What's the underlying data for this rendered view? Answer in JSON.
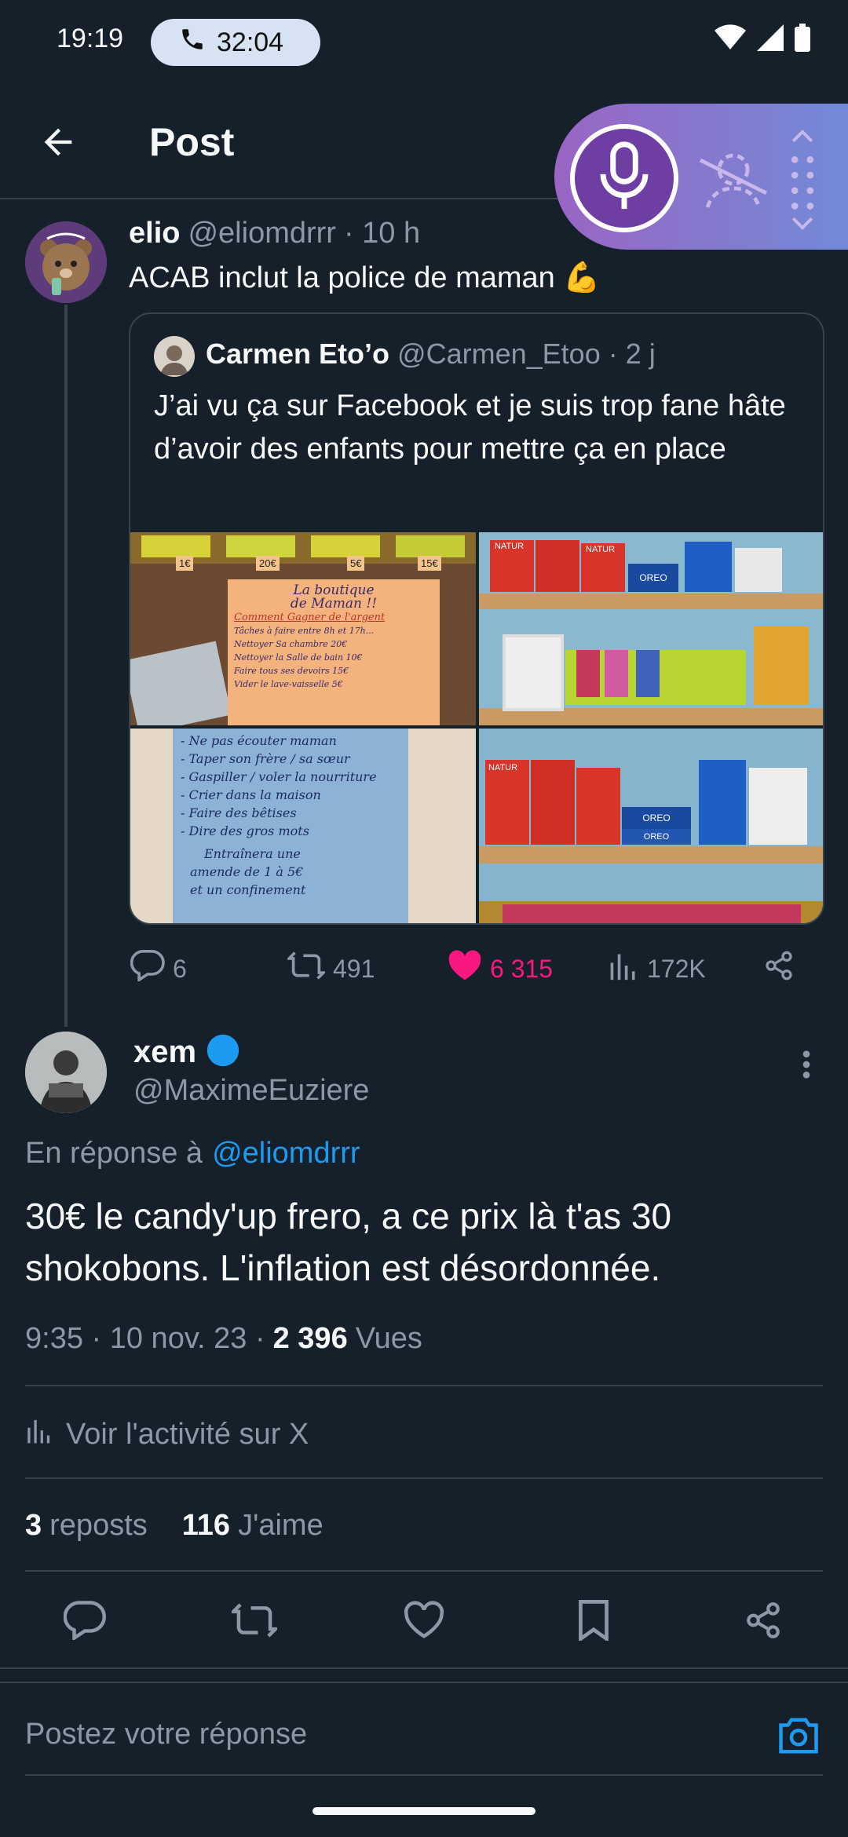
{
  "status": {
    "time": "19:19",
    "call_duration": "32:04"
  },
  "header": {
    "title": "Post"
  },
  "tweet": {
    "author_name": "elio",
    "author_handle": "@eliomdrrr",
    "age": "· 10 h",
    "text": "ACAB inclut la police de maman 💪",
    "quote": {
      "author_name": "Carmen Eto’o",
      "author_handle": "@Carmen_Etoo",
      "age": "· 2 j",
      "text": "J’ai vu ça sur Facebook et je suis trop fane hâte d’avoir des enfants pour mettre ça en place",
      "images": [
        {
          "lines": [
            "La boutique",
            "de Maman !!",
            "Comment Gagner de l'argent",
            "Tâches à faire entre 8h et 17h...",
            "Nettoyer Sa chambre 20€",
            "Nettoyer la Salle de bain 10€",
            "Faire tous ses devoirs 15€",
            "Vider le lave-vaisselle 5€"
          ],
          "prices": [
            "1€",
            "20€",
            "5€",
            "15€"
          ]
        },
        {
          "labels": [
            "NATUR",
            "OREO",
            "NATUR"
          ]
        },
        {
          "lines": [
            "- Ne pas écouter maman",
            "- Taper son frère / sa sœur",
            "- Gaspiller / voler la nourriture",
            "- Crier dans la maison",
            "- Faire des bêtises",
            "- Dire des gros mots",
            "Entraînera une",
            "amende de 1 à 5€",
            "et un confinement"
          ]
        },
        {
          "labels": [
            "NATUR",
            "OREO",
            "OREO"
          ]
        }
      ]
    },
    "replies": "6",
    "reposts": "491",
    "likes": "6 315",
    "views": "172K"
  },
  "reply": {
    "author_name": "xem",
    "author_handle": "@MaximeEuziere",
    "in_reply_prefix": "En réponse à",
    "in_reply_handle": "@eliomdrrr",
    "text": "30€ le candy'up frero, a ce prix là t'as 30 shokobons. L'inflation est désordonnée.",
    "time": "9:35 · 10 nov. 23 ·",
    "views_count": "2 396",
    "views_label": "Vues",
    "activity_label": "Voir l'activité sur X",
    "reposts_count": "3",
    "reposts_label": "reposts",
    "likes_count": "116",
    "likes_label": "J'aime"
  },
  "composer": {
    "placeholder": "Postez votre réponse"
  },
  "colors": {
    "background": "#15202b",
    "accent": "#1d9bf0",
    "like": "#f91880",
    "muted": "#8b98a5",
    "border": "#38444d"
  }
}
